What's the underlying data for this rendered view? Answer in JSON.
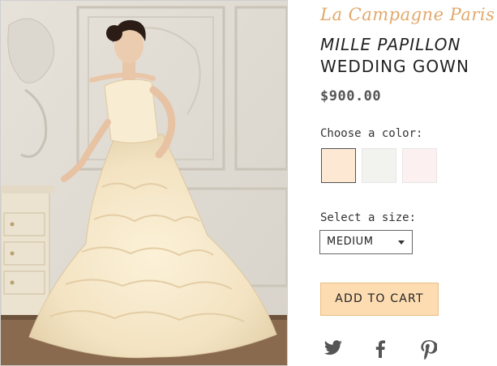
{
  "brand": {
    "name": "La Campagne Paris"
  },
  "product": {
    "title_line1": "MILLE PAPILLON",
    "title_line2": "WEDDING GOWN",
    "price": "$900.00"
  },
  "color_picker": {
    "label": "Choose a color:",
    "swatches": [
      {
        "name": "cream",
        "color": "#fde9d3",
        "selected": true
      },
      {
        "name": "ivory",
        "color": "#f2f2ee",
        "selected": false
      },
      {
        "name": "blush",
        "color": "#fdf0f0",
        "selected": false
      }
    ]
  },
  "size_picker": {
    "label": "Select a size:",
    "selected": "MEDIUM"
  },
  "cart": {
    "button_label": "ADD TO CART"
  },
  "social": {
    "icons": [
      "twitter-icon",
      "facebook-icon",
      "pinterest-icon"
    ]
  },
  "colors": {
    "brand_accent": "#e2a86b",
    "cart_button_bg": "#fddcb2",
    "text_dark": "#222222",
    "icon_gray": "#555555"
  }
}
